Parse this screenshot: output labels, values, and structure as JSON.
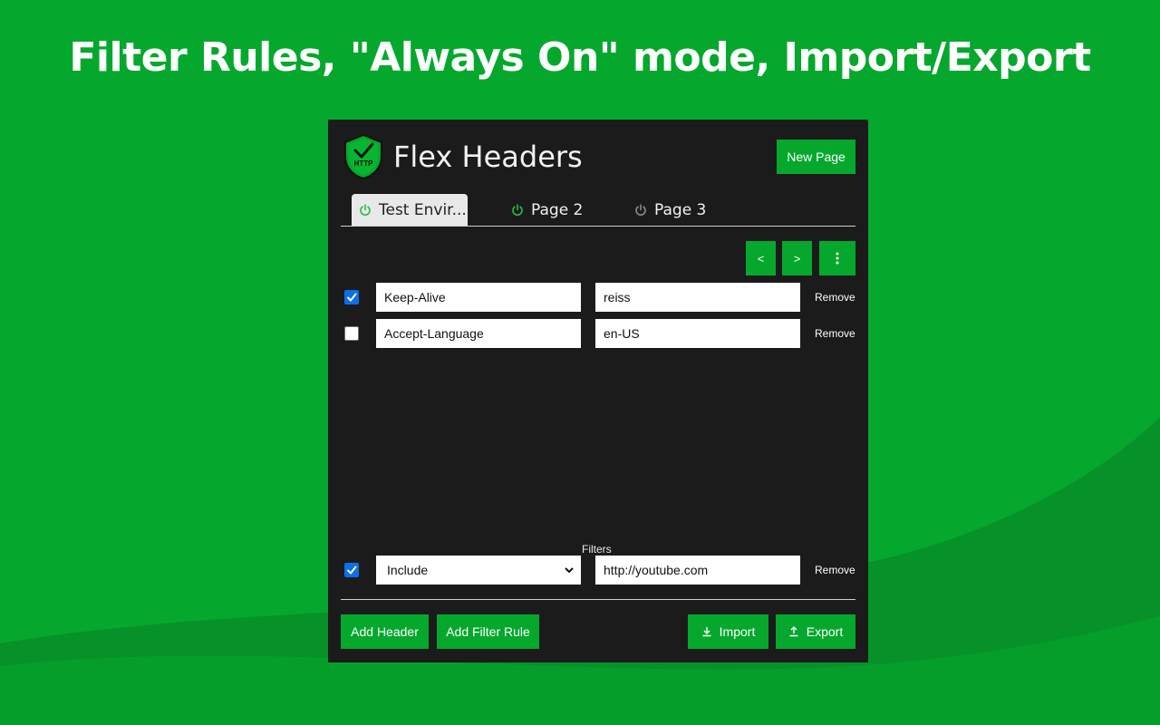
{
  "headline": "Filter Rules, \"Always On\" mode, Import/Export",
  "app": {
    "title": "Flex Headers",
    "logo_text": "HTTP",
    "new_page_label": "New Page"
  },
  "tabs": [
    {
      "label": "Test Envir...",
      "active": true,
      "power": "on"
    },
    {
      "label": "Page 2",
      "active": false,
      "power": "on"
    },
    {
      "label": "Page 3",
      "active": false,
      "power": "off"
    }
  ],
  "nav": {
    "prev_label": "<",
    "next_label": ">",
    "menu_icon": "kebab-icon"
  },
  "headers": [
    {
      "enabled": true,
      "name": "Keep-Alive",
      "value": "reiss",
      "remove_label": "Remove"
    },
    {
      "enabled": false,
      "name": "Accept-Language",
      "value": "en-US",
      "remove_label": "Remove"
    }
  ],
  "filters": {
    "label": "Filters",
    "rules": [
      {
        "enabled": true,
        "mode": "Include",
        "pattern": "http://youtube.com",
        "remove_label": "Remove"
      }
    ]
  },
  "footer": {
    "add_header_label": "Add Header",
    "add_filter_label": "Add Filter Rule",
    "import_label": "Import",
    "export_label": "Export"
  },
  "colors": {
    "background": "#05a82d",
    "accent": "#05a82d",
    "panel": "#1b1b1b",
    "power_on": "#22c045",
    "power_off": "#8a8a8a",
    "checkbox": "#0a6fe8"
  }
}
